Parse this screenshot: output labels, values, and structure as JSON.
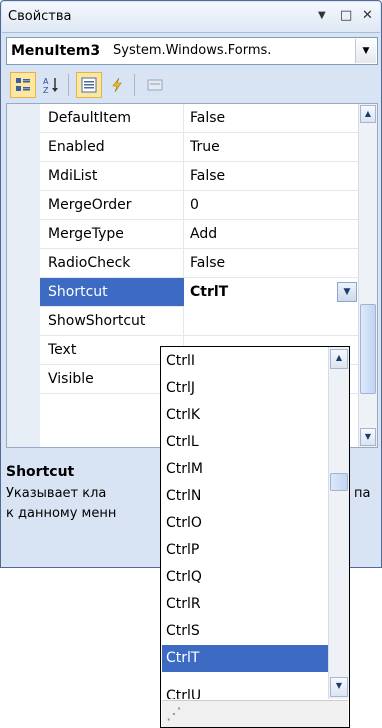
{
  "window": {
    "title": "Свойства",
    "controls": [
      "▼",
      "□",
      "✕"
    ]
  },
  "object_selector": {
    "name": "MenuItem3",
    "type": "System.Windows.Forms.",
    "dropdown_glyph": "▼"
  },
  "toolbar": {
    "buttons": [
      {
        "icon": "categorized-icon",
        "active": true
      },
      {
        "icon": "alphabetical-icon",
        "active": false
      },
      {
        "icon": "properties-icon",
        "active": true
      },
      {
        "icon": "events-icon",
        "active": false
      },
      {
        "icon": "property-pages-icon",
        "active": false
      }
    ],
    "glyphs": {
      "categorized": "▦",
      "alphabetical": "A↓",
      "properties": "▤",
      "events": "⚡",
      "pages": "▭"
    }
  },
  "properties": [
    {
      "name": "DefaultItem",
      "value": "False"
    },
    {
      "name": "Enabled",
      "value": "True"
    },
    {
      "name": "MdiList",
      "value": "False"
    },
    {
      "name": "MergeOrder",
      "value": "0"
    },
    {
      "name": "MergeType",
      "value": "Add"
    },
    {
      "name": "RadioCheck",
      "value": "False"
    },
    {
      "name": "Shortcut",
      "value": "CtrlT",
      "selected": true
    },
    {
      "name": "ShowShortcut",
      "value": ""
    },
    {
      "name": "Text",
      "value": ""
    },
    {
      "name": "Visible",
      "value": ""
    }
  ],
  "scroll": {
    "up": "▲",
    "down": "▼"
  },
  "description": {
    "title": "Shortcut",
    "line1": "Указывает кла",
    "line1_tail": "па",
    "line2": "к данному менн"
  },
  "dropdown": {
    "options": [
      "CtrlI",
      "CtrlJ",
      "CtrlK",
      "CtrlL",
      "CtrlM",
      "CtrlN",
      "CtrlO",
      "CtrlP",
      "CtrlQ",
      "CtrlR",
      "CtrlS",
      "CtrlT",
      "CtrlU"
    ],
    "selected": "CtrlT",
    "grip": "⋰"
  },
  "colors": {
    "selection": "#3d6bc4",
    "frame": "#d8e4f4"
  }
}
